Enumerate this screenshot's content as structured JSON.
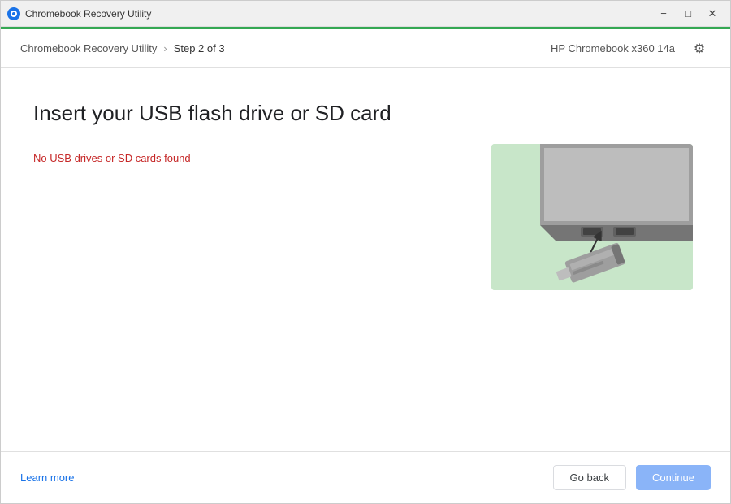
{
  "titlebar": {
    "app_name": "Chromebook Recovery Utility",
    "minimize_label": "−",
    "maximize_label": "□",
    "close_label": "✕"
  },
  "header": {
    "breadcrumb_app": "Chromebook Recovery Utility",
    "breadcrumb_separator": "›",
    "breadcrumb_step": "Step 2 of 3",
    "device_name": "HP Chromebook x360 14a",
    "gear_icon": "⚙"
  },
  "main": {
    "page_title": "Insert your USB flash drive or SD card",
    "no_drives_message": "No USB drives or SD cards found"
  },
  "footer": {
    "learn_more_label": "Learn more",
    "go_back_label": "Go back",
    "continue_label": "Continue"
  },
  "colors": {
    "accent_green": "#34a853",
    "accent_blue": "#1a73e8",
    "error_red": "#c62828",
    "illustration_bg": "#c8e6c9",
    "continue_btn": "#8ab4f8"
  }
}
